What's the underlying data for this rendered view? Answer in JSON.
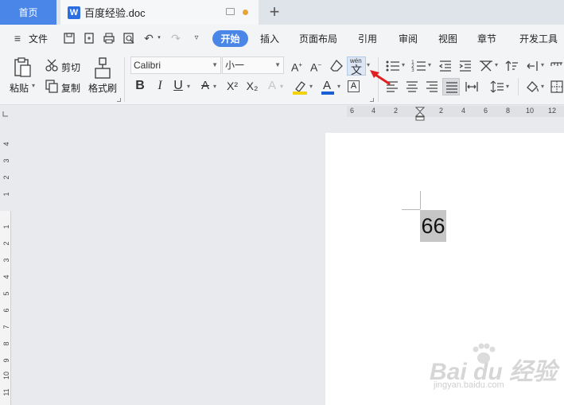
{
  "tabs": {
    "home": "首页",
    "document": "百度经验.doc"
  },
  "menu": {
    "file": "文件",
    "items": [
      "开始",
      "插入",
      "页面布局",
      "引用",
      "审阅",
      "视图",
      "章节",
      "开发工具"
    ]
  },
  "ribbon": {
    "paste": "粘贴",
    "cut": "剪切",
    "copy": "复制",
    "format_painter": "格式刷",
    "font_name": "Calibri",
    "font_size": "小一",
    "bold": "B",
    "italic": "I",
    "underline": "U",
    "superscript": "X²",
    "subscript": "X₂",
    "phonetic_guide": "wén",
    "phonetic_char": "文",
    "char_border": "A"
  },
  "ruler": {
    "horizontal": [
      "6",
      "4",
      "2",
      "2",
      "4",
      "6",
      "8",
      "10",
      "12"
    ],
    "vertical": [
      "4",
      "3",
      "2",
      "1",
      "1",
      "2",
      "3",
      "4",
      "5",
      "6",
      "7",
      "8",
      "9",
      "10",
      "11"
    ]
  },
  "document": {
    "text": "66"
  },
  "watermark": {
    "logo": "Bai du 经验",
    "url": "jingyan.baidu.com"
  },
  "colors": {
    "accent": "#4a86e8",
    "highlight": "#f2d10d",
    "font_color": "#1a5fd6",
    "annotation_arrow": "#e02020"
  }
}
